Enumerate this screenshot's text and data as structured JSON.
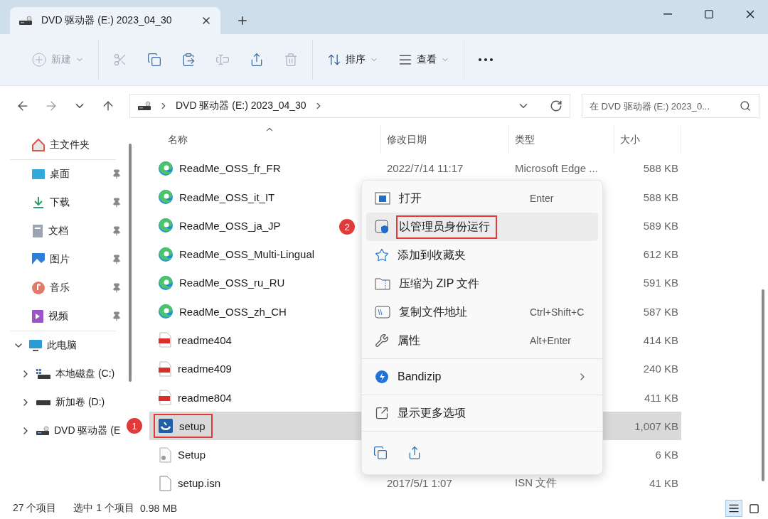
{
  "window": {
    "tab_title": "DVD 驱动器 (E:) 2023_04_30"
  },
  "toolbar": {
    "groups": [
      [
        {
          "kind": "new",
          "label": "新建",
          "disabled": true
        }
      ],
      [
        {
          "kind": "cut",
          "disabled": true
        },
        {
          "kind": "copy",
          "disabled": false
        },
        {
          "kind": "paste",
          "disabled": false
        },
        {
          "kind": "rename",
          "disabled": true
        },
        {
          "kind": "share",
          "disabled": false
        },
        {
          "kind": "delete",
          "disabled": true
        }
      ],
      [
        {
          "kind": "sort",
          "label": "排序",
          "disabled": false
        },
        {
          "kind": "view",
          "label": "查看",
          "disabled": false
        }
      ],
      [
        {
          "kind": "more"
        }
      ]
    ]
  },
  "address": {
    "path": [
      "DVD 驱动器 (E:) 2023_04_30"
    ]
  },
  "search": {
    "placeholder": "在 DVD 驱动器 (E:) 2023_0..."
  },
  "sidebar": {
    "groups": [
      [
        {
          "label": "主文件夹",
          "kind": "home",
          "pinned": false
        }
      ],
      [
        {
          "label": "桌面",
          "kind": "desktop",
          "pinned": true
        },
        {
          "label": "下载",
          "kind": "download",
          "pinned": true
        },
        {
          "label": "文档",
          "kind": "document",
          "pinned": true
        },
        {
          "label": "图片",
          "kind": "picture",
          "pinned": true
        },
        {
          "label": "音乐",
          "kind": "music",
          "pinned": true
        },
        {
          "label": "视频",
          "kind": "video",
          "pinned": true
        }
      ]
    ],
    "tree": [
      {
        "label": "此电脑",
        "kind": "pc",
        "expanded": true,
        "children": [
          {
            "label": "本地磁盘 (C:)",
            "kind": "system-disk",
            "expanded": false
          },
          {
            "label": "新加卷 (D:)",
            "kind": "disk",
            "expanded": false
          },
          {
            "label": "DVD 驱动器 (E",
            "kind": "dvd",
            "expanded": false
          }
        ]
      }
    ]
  },
  "columns": [
    {
      "label": "名称",
      "sorted": true
    },
    {
      "label": "修改日期",
      "sorted": false
    },
    {
      "label": "类型",
      "sorted": false
    },
    {
      "label": "大小",
      "sorted": false
    }
  ],
  "rows": [
    {
      "name": "ReadMe_OSS_fr_FR",
      "kind": "edge",
      "date": "2022/7/14 11:17",
      "type": "Microsoft Edge ...",
      "size": "588 KB",
      "selected": false
    },
    {
      "name": "ReadMe_OSS_it_IT",
      "kind": "edge",
      "size": "588 KB",
      "selected": false
    },
    {
      "name": "ReadMe_OSS_ja_JP",
      "kind": "edge",
      "size": "589 KB",
      "selected": false
    },
    {
      "name": "ReadMe_OSS_Multi-Lingual",
      "kind": "edge",
      "size": "612 KB",
      "selected": false
    },
    {
      "name": "ReadMe_OSS_ru_RU",
      "kind": "edge",
      "size": "591 KB",
      "selected": false
    },
    {
      "name": "ReadMe_OSS_zh_CH",
      "kind": "edge",
      "size": "587 KB",
      "selected": false
    },
    {
      "name": "readme404",
      "kind": "pdf",
      "size": "414 KB",
      "selected": false
    },
    {
      "name": "readme409",
      "kind": "pdf",
      "size": "240 KB",
      "selected": false
    },
    {
      "name": "readme804",
      "kind": "pdf",
      "size": "411 KB",
      "selected": false
    },
    {
      "name": "setup",
      "kind": "installer",
      "size": "1,007 KB",
      "selected": true,
      "badge": "1"
    },
    {
      "name": "Setup",
      "kind": "settings-file",
      "size": "6 KB",
      "selected": false
    },
    {
      "name": "setup.isn",
      "kind": "blank",
      "date": "2017/5/1 1:07",
      "type": "ISN 文件",
      "size": "41 KB",
      "selected": false
    }
  ],
  "menu": {
    "items": [
      {
        "kind": "item",
        "label": "打开",
        "shortcut": "Enter",
        "selected": false
      },
      {
        "kind": "item",
        "label": "以管理员身份运行",
        "selected": true,
        "badge": "2"
      },
      {
        "kind": "item",
        "label": "添加到收藏夹",
        "selected": false
      },
      {
        "kind": "item",
        "label": "压缩为 ZIP 文件",
        "selected": false
      },
      {
        "kind": "item",
        "label": "复制文件地址",
        "shortcut": "Ctrl+Shift+C",
        "selected": false
      },
      {
        "kind": "item",
        "label": "属性",
        "shortcut": "Alt+Enter",
        "selected": false
      },
      {
        "kind": "separator"
      },
      {
        "kind": "item",
        "label": "Bandizip",
        "submenu": true,
        "selected": false
      },
      {
        "kind": "separator"
      },
      {
        "kind": "item",
        "label": "显示更多选项",
        "selected": false
      },
      {
        "kind": "separator"
      },
      {
        "kind": "icons"
      }
    ]
  },
  "status": {
    "count": "27 个项目",
    "selection": "选中 1 个项目",
    "size": "0.98 MB"
  },
  "view_buttons": [
    {
      "kind": "details",
      "selected": true
    },
    {
      "kind": "tiles",
      "selected": false
    }
  ]
}
